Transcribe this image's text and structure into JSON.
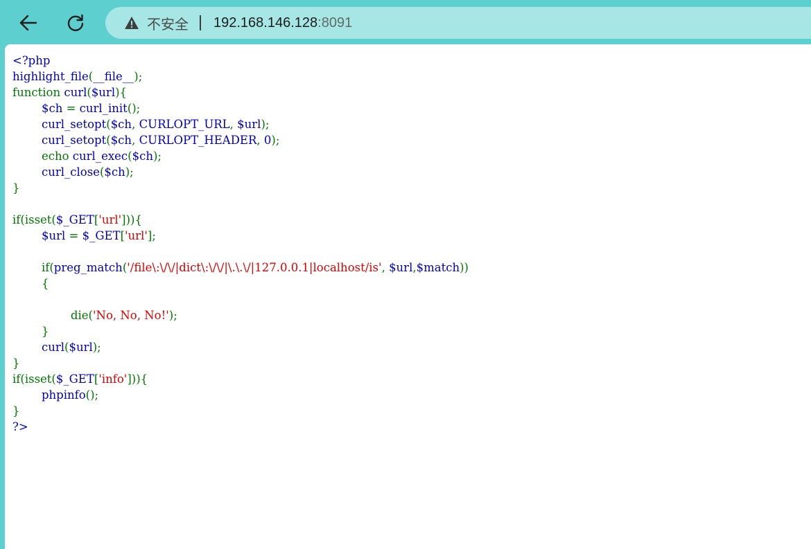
{
  "browser": {
    "security_label": "不安全",
    "url_host": "192.168.146.128",
    "url_port": ":8091",
    "icons": {
      "back": "arrow-left-icon",
      "reload": "reload-icon",
      "security": "warning-triangle-icon"
    }
  },
  "colors": {
    "default": "#0000BB",
    "keyword": "#007700",
    "string": "#DD0000"
  },
  "code_lines": [
    [
      {
        "t": "<?php",
        "c": "def"
      }
    ],
    [
      {
        "t": "highlight_file",
        "c": "def"
      },
      {
        "t": "(",
        "c": "kw"
      },
      {
        "t": "__file__",
        "c": "def"
      },
      {
        "t": ");",
        "c": "kw"
      }
    ],
    [
      {
        "t": "function ",
        "c": "kw"
      },
      {
        "t": "curl",
        "c": "def"
      },
      {
        "t": "(",
        "c": "kw"
      },
      {
        "t": "$url",
        "c": "def"
      },
      {
        "t": "){",
        "c": "kw"
      }
    ],
    [
      {
        "t": "        ",
        "c": "def"
      },
      {
        "t": "$ch ",
        "c": "def"
      },
      {
        "t": "= ",
        "c": "kw"
      },
      {
        "t": "curl_init",
        "c": "def"
      },
      {
        "t": "();",
        "c": "kw"
      }
    ],
    [
      {
        "t": "        ",
        "c": "def"
      },
      {
        "t": "curl_setopt",
        "c": "def"
      },
      {
        "t": "(",
        "c": "kw"
      },
      {
        "t": "$ch",
        "c": "def"
      },
      {
        "t": ", ",
        "c": "kw"
      },
      {
        "t": "CURLOPT_URL",
        "c": "def"
      },
      {
        "t": ", ",
        "c": "kw"
      },
      {
        "t": "$url",
        "c": "def"
      },
      {
        "t": ");",
        "c": "kw"
      }
    ],
    [
      {
        "t": "        ",
        "c": "def"
      },
      {
        "t": "curl_setopt",
        "c": "def"
      },
      {
        "t": "(",
        "c": "kw"
      },
      {
        "t": "$ch",
        "c": "def"
      },
      {
        "t": ", ",
        "c": "kw"
      },
      {
        "t": "CURLOPT_HEADER",
        "c": "def"
      },
      {
        "t": ", ",
        "c": "kw"
      },
      {
        "t": "0",
        "c": "def"
      },
      {
        "t": ");",
        "c": "kw"
      }
    ],
    [
      {
        "t": "        ",
        "c": "def"
      },
      {
        "t": "echo ",
        "c": "kw"
      },
      {
        "t": "curl_exec",
        "c": "def"
      },
      {
        "t": "(",
        "c": "kw"
      },
      {
        "t": "$ch",
        "c": "def"
      },
      {
        "t": ");",
        "c": "kw"
      }
    ],
    [
      {
        "t": "        ",
        "c": "def"
      },
      {
        "t": "curl_close",
        "c": "def"
      },
      {
        "t": "(",
        "c": "kw"
      },
      {
        "t": "$ch",
        "c": "def"
      },
      {
        "t": ");",
        "c": "kw"
      }
    ],
    [
      {
        "t": "}",
        "c": "kw"
      }
    ],
    [],
    [
      {
        "t": "if(isset(",
        "c": "kw"
      },
      {
        "t": "$_GET",
        "c": "def"
      },
      {
        "t": "[",
        "c": "kw"
      },
      {
        "t": "'url'",
        "c": "str"
      },
      {
        "t": "])){",
        "c": "kw"
      }
    ],
    [
      {
        "t": "        ",
        "c": "def"
      },
      {
        "t": "$url ",
        "c": "def"
      },
      {
        "t": "= ",
        "c": "kw"
      },
      {
        "t": "$_GET",
        "c": "def"
      },
      {
        "t": "[",
        "c": "kw"
      },
      {
        "t": "'url'",
        "c": "str"
      },
      {
        "t": "];",
        "c": "kw"
      }
    ],
    [],
    [
      {
        "t": "        ",
        "c": "def"
      },
      {
        "t": "if(",
        "c": "kw"
      },
      {
        "t": "preg_match",
        "c": "def"
      },
      {
        "t": "(",
        "c": "kw"
      },
      {
        "t": "'/file\\:\\/\\/|dict\\:\\/\\/|\\.\\.\\/|127.0.0.1|localhost/is'",
        "c": "str"
      },
      {
        "t": ", ",
        "c": "kw"
      },
      {
        "t": "$url",
        "c": "def"
      },
      {
        "t": ",",
        "c": "kw"
      },
      {
        "t": "$match",
        "c": "def"
      },
      {
        "t": "))",
        "c": "kw"
      }
    ],
    [
      {
        "t": "        ",
        "c": "def"
      },
      {
        "t": "{",
        "c": "kw"
      }
    ],
    [],
    [
      {
        "t": "                ",
        "c": "def"
      },
      {
        "t": "die(",
        "c": "kw"
      },
      {
        "t": "'No, No, No!'",
        "c": "str"
      },
      {
        "t": ");",
        "c": "kw"
      }
    ],
    [
      {
        "t": "        ",
        "c": "def"
      },
      {
        "t": "}",
        "c": "kw"
      }
    ],
    [
      {
        "t": "        ",
        "c": "def"
      },
      {
        "t": "curl",
        "c": "def"
      },
      {
        "t": "(",
        "c": "kw"
      },
      {
        "t": "$url",
        "c": "def"
      },
      {
        "t": ");",
        "c": "kw"
      }
    ],
    [
      {
        "t": "}",
        "c": "kw"
      }
    ],
    [
      {
        "t": "if(isset(",
        "c": "kw"
      },
      {
        "t": "$_GET",
        "c": "def"
      },
      {
        "t": "[",
        "c": "kw"
      },
      {
        "t": "'info'",
        "c": "str"
      },
      {
        "t": "])){",
        "c": "kw"
      }
    ],
    [
      {
        "t": "        ",
        "c": "def"
      },
      {
        "t": "phpinfo",
        "c": "def"
      },
      {
        "t": "();",
        "c": "kw"
      }
    ],
    [
      {
        "t": "}",
        "c": "kw"
      }
    ],
    [
      {
        "t": "?>",
        "c": "def"
      }
    ]
  ]
}
